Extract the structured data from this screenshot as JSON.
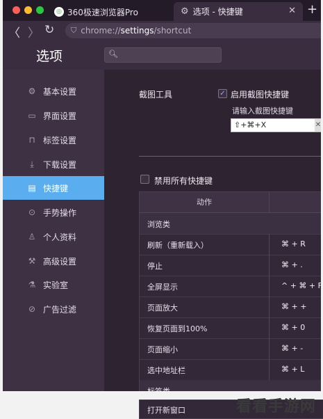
{
  "tabs": [
    {
      "label": "360极速浏览器Pro",
      "favicon": "360-logo-icon"
    },
    {
      "label": "选项 - 快捷键",
      "favicon": "gear-icon"
    }
  ],
  "address": {
    "prefix": "chrome://",
    "bold": "settings",
    "suffix": "/shortcut"
  },
  "page_title": "选项",
  "sidebar": {
    "items": [
      {
        "label": "基本设置",
        "icon": "gear-icon"
      },
      {
        "label": "界面设置",
        "icon": "window-icon"
      },
      {
        "label": "标签设置",
        "icon": "tab-icon"
      },
      {
        "label": "下载设置",
        "icon": "download-icon"
      },
      {
        "label": "快捷键",
        "icon": "keyboard-icon",
        "active": true
      },
      {
        "label": "手势操作",
        "icon": "mouse-icon"
      },
      {
        "label": "个人资料",
        "icon": "person-icon"
      },
      {
        "label": "高级设置",
        "icon": "wrench-icon"
      },
      {
        "label": "实验室",
        "icon": "flask-icon"
      },
      {
        "label": "广告过滤",
        "icon": "block-icon"
      }
    ]
  },
  "screenshot_tool": {
    "label": "截图工具",
    "enable_label": "启用截图快捷键",
    "enabled": true,
    "hint": "请输入截图快捷键",
    "value": "⇧+⌘+X"
  },
  "disable_all_label": "禁用所有快捷键",
  "table": {
    "header_action": "动作",
    "rows": [
      {
        "name": "浏览类",
        "group": true,
        "keys": ""
      },
      {
        "name": "刷新（重新载入）",
        "keys": "⌘ + R"
      },
      {
        "name": "停止",
        "keys": "⌘ + ."
      },
      {
        "name": "全屏显示",
        "keys": "^ + ⌘ + F"
      },
      {
        "name": "页面放大",
        "keys": "⌘ + +"
      },
      {
        "name": "恢复页面到100%",
        "keys": "⌘ + 0"
      },
      {
        "name": "页面缩小",
        "keys": "⌘ + -"
      },
      {
        "name": "选中地址栏",
        "keys": "⌘ + L"
      },
      {
        "name": "标签类",
        "group": true,
        "keys": ""
      },
      {
        "name": "打开新窗口",
        "keys": ""
      }
    ]
  },
  "watermark": "看看手游网"
}
